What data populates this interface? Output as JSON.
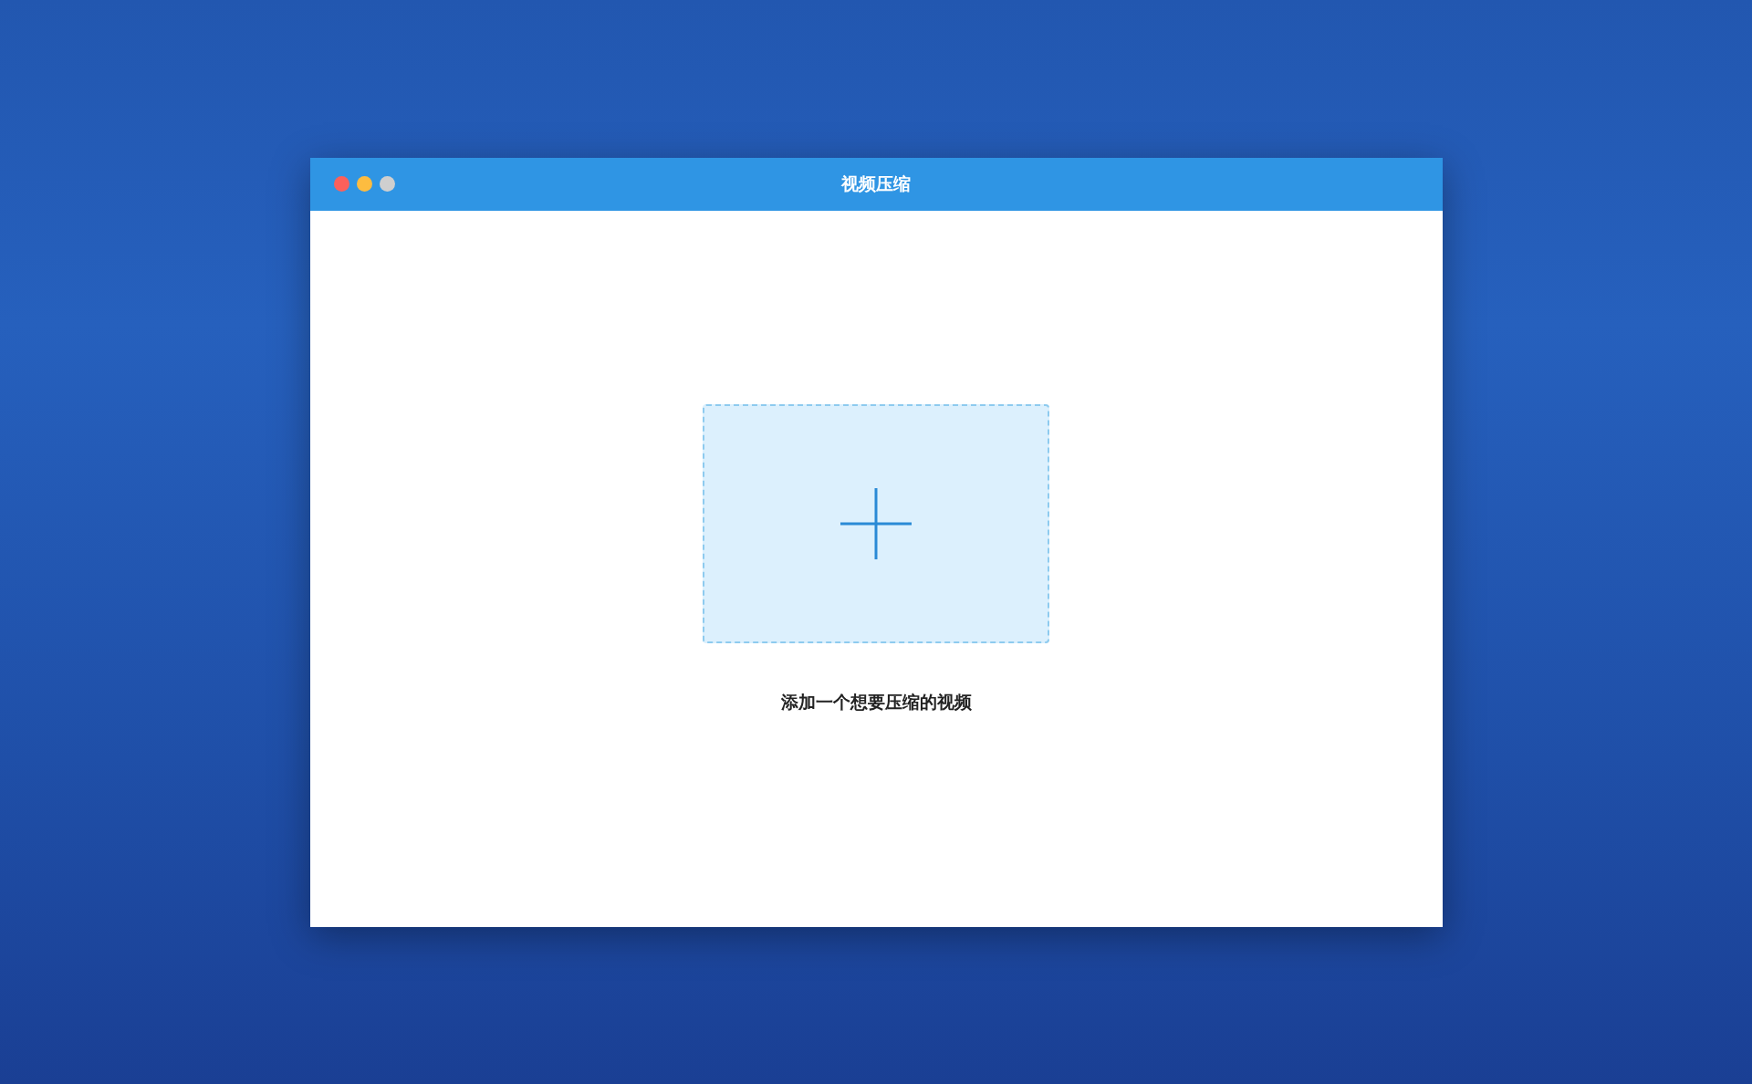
{
  "window": {
    "title": "视频压缩",
    "controls": [
      {
        "color": "#fc605b"
      },
      {
        "color": "#fdbc40"
      },
      {
        "color": "#cfcfcf"
      }
    ]
  },
  "drop_zone": {
    "label": "添加一个想要压缩的视频"
  }
}
